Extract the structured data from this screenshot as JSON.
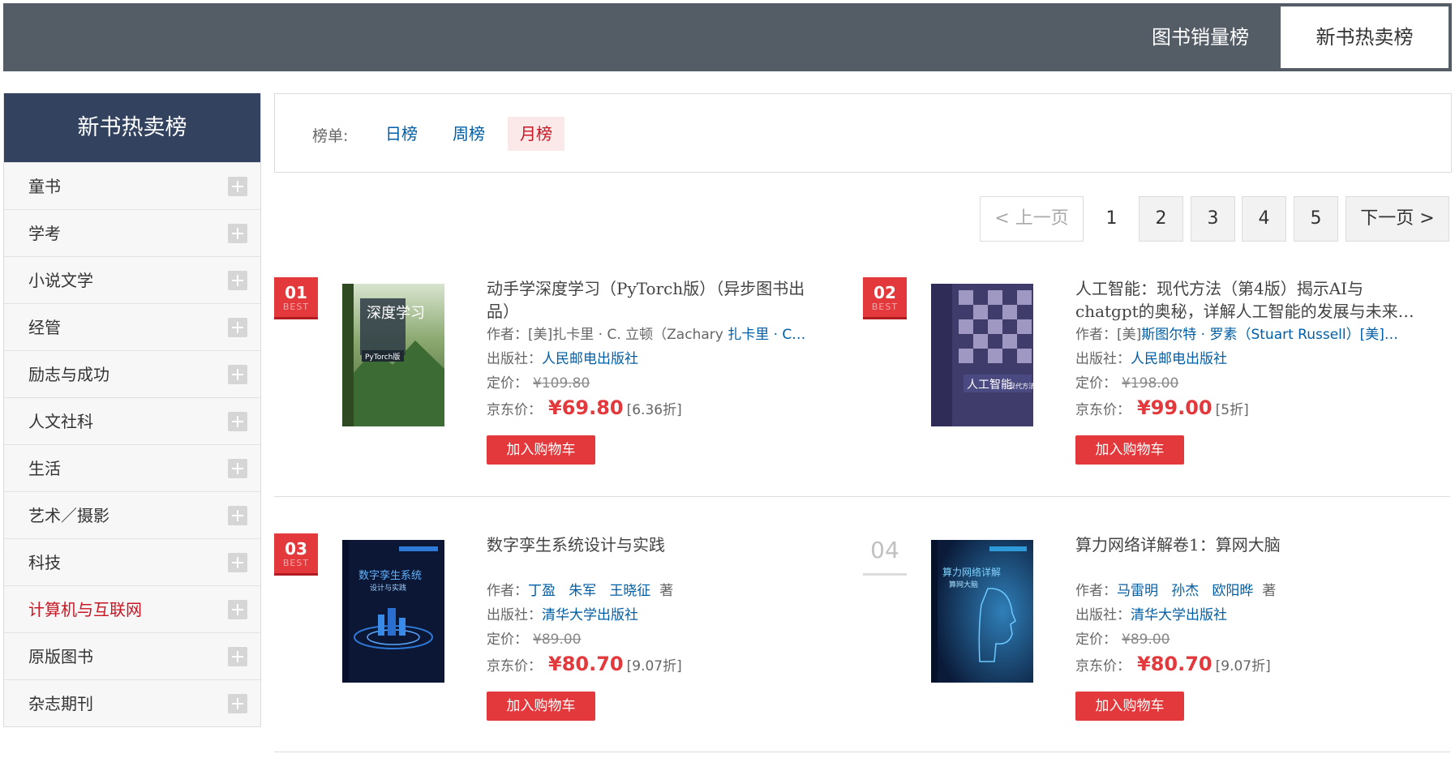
{
  "topnav": {
    "tabs": [
      {
        "label": "图书销量榜",
        "active": false
      },
      {
        "label": "新书热卖榜",
        "active": true
      }
    ]
  },
  "sidebar": {
    "title": "新书热卖榜",
    "items": [
      {
        "label": "童书"
      },
      {
        "label": "学考"
      },
      {
        "label": "小说文学"
      },
      {
        "label": "经管"
      },
      {
        "label": "励志与成功"
      },
      {
        "label": "人文社科"
      },
      {
        "label": "生活"
      },
      {
        "label": "艺术／摄影"
      },
      {
        "label": "科技"
      },
      {
        "label": "计算机与互联网",
        "active": true
      },
      {
        "label": "原版图书"
      },
      {
        "label": "杂志期刊"
      }
    ]
  },
  "filter": {
    "label": "榜单:",
    "options": [
      {
        "label": "日榜"
      },
      {
        "label": "周榜"
      },
      {
        "label": "月榜",
        "selected": true
      }
    ]
  },
  "pagination": {
    "prev": "< 上一页",
    "pages": [
      "1",
      "2",
      "3",
      "4",
      "5"
    ],
    "current": "1",
    "next": "下一页 >"
  },
  "books": [
    {
      "rank": "01",
      "badge": "BEST",
      "title": "动手学深度学习（PyTorch版）（异步图书出品）",
      "author_label": "作者：",
      "author_prefix": "[美]扎卡里 · C. 立顿（Zachary ",
      "author_link": "扎卡里 · C…",
      "publisher_label": "出版社：",
      "publisher": "人民邮电出版社",
      "list_label": "定价：",
      "list_price": "¥109.80",
      "jd_label": "京东价：",
      "jd_price": "¥69.80",
      "discount": "[6.36折]",
      "cart": "加入购物车",
      "cover": {
        "title": "深度学习",
        "sub": "PyTorch版",
        "colors": [
          "#6f8f5a",
          "#b7c9a6"
        ]
      }
    },
    {
      "rank": "02",
      "badge": "BEST",
      "title": "人工智能：现代方法（第4版）揭示AI与chatgpt的奥秘，详解人工智能的发展与未来…",
      "author_label": "作者：",
      "author_prefix": "[美]",
      "author_link": "斯图尔特 · 罗素（Stuart Russell）[美]…",
      "publisher_label": "出版社：",
      "publisher": "人民邮电出版社",
      "list_label": "定价：",
      "list_price": "¥198.00",
      "jd_label": "京东价：",
      "jd_price": "¥99.00",
      "discount": "[5折]",
      "cart": "加入购物车",
      "cover": {
        "title": "人工智能",
        "sub": "现代方法",
        "colors": [
          "#4b4a7a",
          "#a89cc8"
        ]
      }
    },
    {
      "rank": "03",
      "badge": "BEST",
      "title": "数字孪生系统设计与实践",
      "author_label": "作者：",
      "authors": [
        "丁盈",
        "朱军",
        "王晓征"
      ],
      "author_suffix": "著",
      "publisher_label": "出版社：",
      "publisher": "清华大学出版社",
      "list_label": "定价：",
      "list_price": "¥89.00",
      "jd_label": "京东价：",
      "jd_price": "¥80.70",
      "discount": "[9.07折]",
      "cart": "加入购物车",
      "cover": {
        "title": "数字孪生系统",
        "sub": "设计与实践",
        "colors": [
          "#0d1a3c",
          "#1e4fa0"
        ]
      }
    },
    {
      "rank": "04",
      "badge": "",
      "title": "算力网络详解卷1：算网大脑",
      "author_label": "作者：",
      "authors": [
        "马雷明",
        "孙杰",
        "欧阳晔"
      ],
      "author_suffix": "著",
      "publisher_label": "出版社：",
      "publisher": "清华大学出版社",
      "list_label": "定价：",
      "list_price": "¥89.00",
      "jd_label": "京东价：",
      "jd_price": "¥80.70",
      "discount": "[9.07折]",
      "cart": "加入购物车",
      "cover": {
        "title": "算力网络详解",
        "sub": "算网大脑",
        "colors": [
          "#0b1b3a",
          "#2a6a9e"
        ]
      }
    }
  ]
}
